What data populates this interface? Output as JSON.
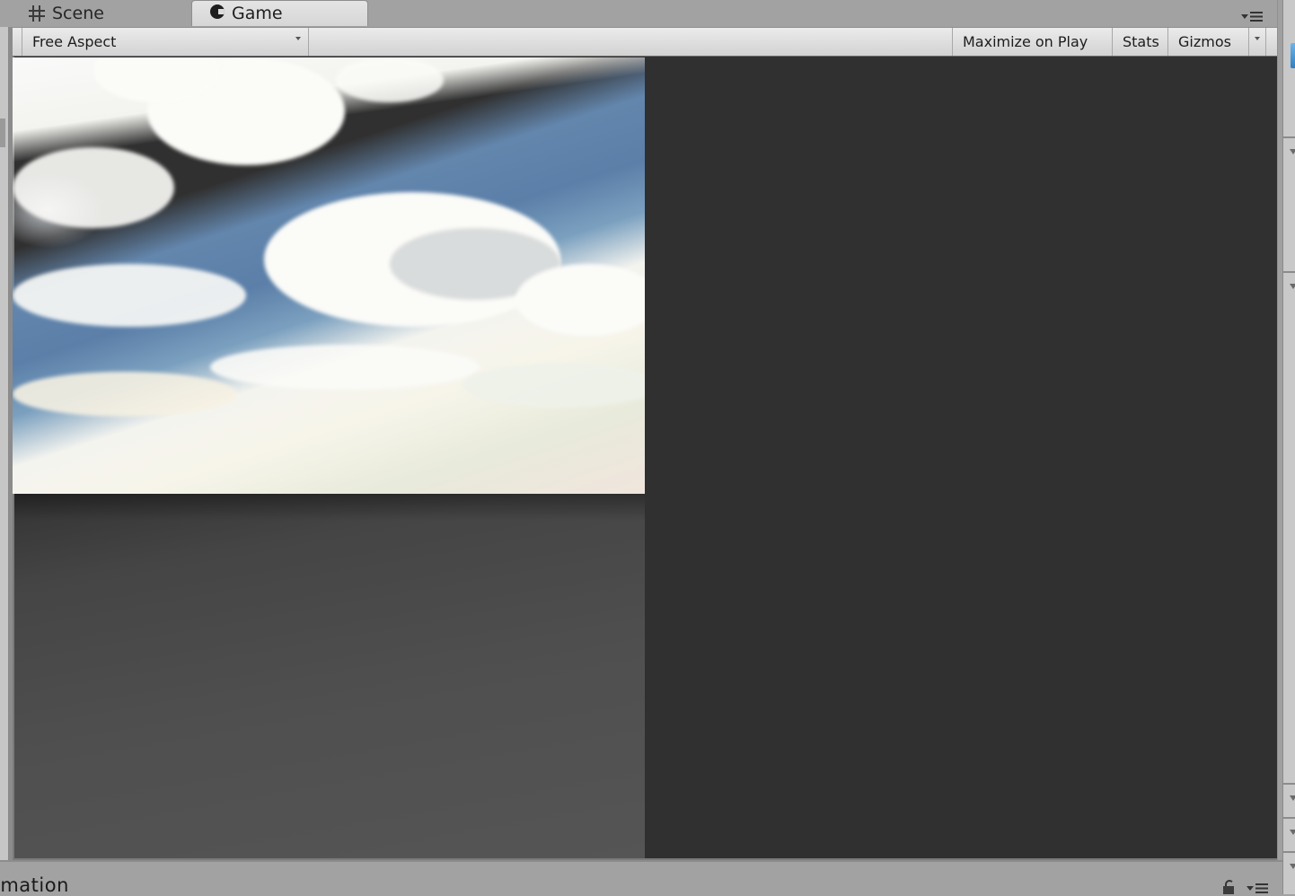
{
  "tabs": [
    {
      "label": "Scene",
      "icon": "grid-hash-icon",
      "active": false
    },
    {
      "label": "Game",
      "icon": "pacman-game-icon",
      "active": true
    }
  ],
  "toolbar": {
    "aspect": {
      "selected": "Free Aspect"
    },
    "maximize_on_play": "Maximize on Play",
    "stats": "Stats",
    "gizmos": "Gizmos"
  },
  "game_view": {
    "render": "skybox with clouds",
    "colors": {
      "background": "#303030",
      "sky_blue": "#5b7fa8",
      "cloud": "#fbfbf8"
    }
  },
  "bottom_panel": {
    "title": "imation"
  },
  "panel_menu_icon": "panel-options-icon"
}
